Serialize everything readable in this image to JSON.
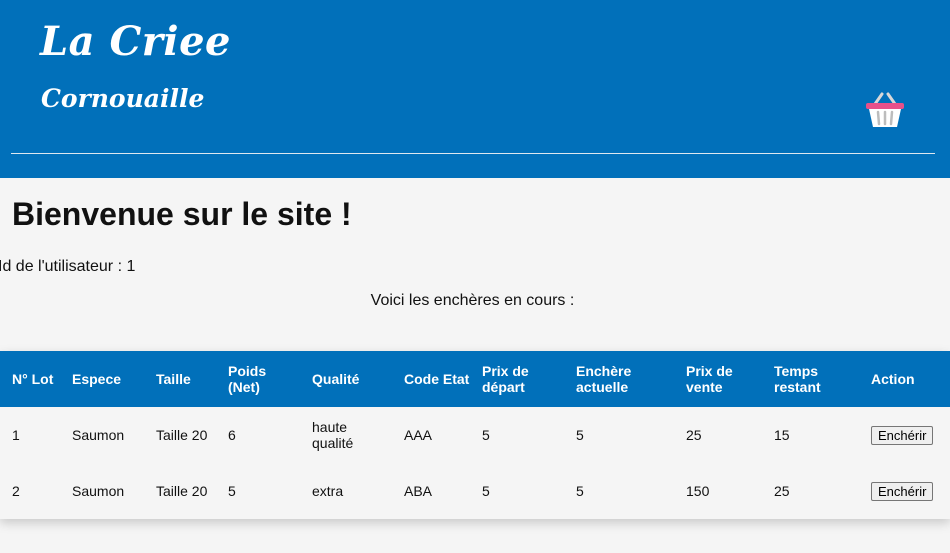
{
  "header": {
    "brand": "La Criee",
    "subtitle": "Cornouaille",
    "cart_icon": "shopping-basket-icon"
  },
  "main": {
    "welcome": "Bienvenue sur le site !",
    "user_id_text": "Id de l'utilisateur : 1",
    "intro": "Voici les enchères en cours :"
  },
  "table": {
    "headers": [
      "N° Lot",
      "Espece",
      "Taille",
      "Poids (Net)",
      "Qualité",
      "Code Etat",
      "Prix de départ",
      "Enchère actuelle",
      "Prix de vente",
      "Temps restant",
      "Action"
    ],
    "rows": [
      {
        "lot": "1",
        "espece": "Saumon",
        "taille": "Taille 20",
        "poids": "6",
        "qualite": "haute qualité",
        "code_etat": "AAA",
        "prix_depart": "5",
        "enchere_actuelle": "5",
        "prix_vente": "25",
        "temps_restant": "15",
        "action_label": "Enchérir"
      },
      {
        "lot": "2",
        "espece": "Saumon",
        "taille": "Taille 20",
        "poids": "5",
        "qualite": "extra",
        "code_etat": "ABA",
        "prix_depart": "5",
        "enchere_actuelle": "5",
        "prix_vente": "150",
        "temps_restant": "25",
        "action_label": "Enchérir"
      }
    ]
  },
  "colors": {
    "primary": "#0170ba",
    "background": "#f5f5f5",
    "basket_rim": "#e8508a"
  }
}
